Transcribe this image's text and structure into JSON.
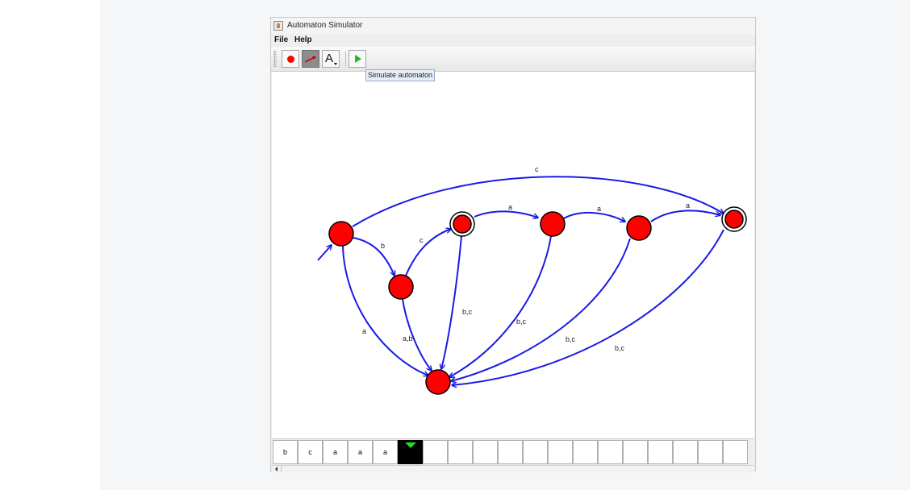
{
  "window": {
    "title": "Automaton Simulator",
    "icon": "java-cup-icon"
  },
  "menu": {
    "items": [
      {
        "label": "File"
      },
      {
        "label": "Help"
      }
    ]
  },
  "toolbar": {
    "tools": [
      {
        "name": "add-state",
        "icon": "red-dot-icon"
      },
      {
        "name": "add-transition",
        "icon": "arrow-icon",
        "selected": true
      },
      {
        "name": "add-label",
        "icon": "letter-a-icon",
        "glyph": "A"
      },
      {
        "name": "simulate",
        "icon": "play-icon"
      }
    ],
    "tooltip": "Simulate automaton"
  },
  "automaton": {
    "colors": {
      "edge": "#1a1ae6",
      "state": "#ff0000",
      "active_state": "#00ee00"
    },
    "states": [
      {
        "id": "q0",
        "initial": true,
        "accepting": false,
        "active": false
      },
      {
        "id": "q1",
        "initial": false,
        "accepting": false,
        "active": false
      },
      {
        "id": "q2",
        "initial": false,
        "accepting": true,
        "active": false
      },
      {
        "id": "q3",
        "initial": false,
        "accepting": false,
        "active": false
      },
      {
        "id": "q4",
        "initial": false,
        "accepting": false,
        "active": false
      },
      {
        "id": "q5",
        "initial": false,
        "accepting": true,
        "active": true
      },
      {
        "id": "q6",
        "initial": false,
        "accepting": false,
        "active": false
      }
    ],
    "transitions": [
      {
        "from": "q0",
        "to": "q5",
        "label": "c"
      },
      {
        "from": "q0",
        "to": "q1",
        "label": "b"
      },
      {
        "from": "q0",
        "to": "q6",
        "label": "a"
      },
      {
        "from": "q1",
        "to": "q2",
        "label": "c"
      },
      {
        "from": "q1",
        "to": "q6",
        "label": "a,b"
      },
      {
        "from": "q2",
        "to": "q3",
        "label": "a"
      },
      {
        "from": "q2",
        "to": "q6",
        "label": "b,c"
      },
      {
        "from": "q3",
        "to": "q4",
        "label": "a"
      },
      {
        "from": "q3",
        "to": "q6",
        "label": "b,c"
      },
      {
        "from": "q4",
        "to": "q5",
        "label": "a"
      },
      {
        "from": "q4",
        "to": "q6",
        "label": "b,c"
      },
      {
        "from": "q5",
        "to": "q6",
        "label": "b,c"
      }
    ]
  },
  "tape": {
    "cells": [
      "b",
      "c",
      "a",
      "a",
      "a",
      "",
      "",
      "",
      "",
      "",
      "",
      "",
      "",
      "",
      "",
      "",
      "",
      "",
      ""
    ],
    "head_index": 5
  }
}
